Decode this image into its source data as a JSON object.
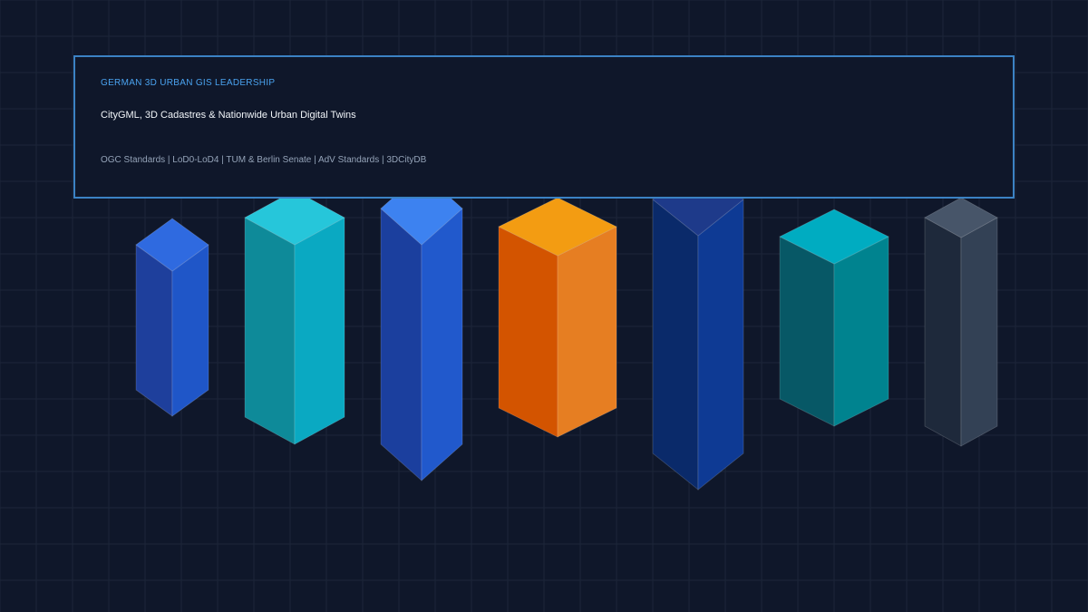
{
  "header": {
    "kicker": "GERMAN 3D URBAN GIS LEADERSHIP",
    "headline": "CityGML, 3D Cadastres & Nationwide Urban Digital Twins",
    "tags": "OGC Standards | LoD0-LoD4 | TUM & Berlin Senate | AdV Standards | 3DCityDB"
  },
  "colors": {
    "background": "#0f172a",
    "grid": "#1c2639",
    "panel_border": "#3b82c4",
    "kicker": "#4aa3f0"
  },
  "buildings": [
    {
      "name": "building-1",
      "top": "#2f6ae0",
      "left": "#1e3f9c",
      "right": "#1f56c8"
    },
    {
      "name": "building-2",
      "top": "#26c6da",
      "left": "#0e8a99",
      "right": "#0aa9c2"
    },
    {
      "name": "building-3",
      "top": "#3d82f0",
      "left": "#1b3f9e",
      "right": "#2159cc"
    },
    {
      "name": "building-4",
      "top": "#f39c12",
      "left": "#d35400",
      "right": "#e67e22"
    },
    {
      "name": "building-5",
      "top": "#1e3a8a",
      "left": "#0a2a6a",
      "right": "#0e3a94"
    },
    {
      "name": "building-6",
      "top": "#00acc1",
      "left": "#075866",
      "right": "#00838f"
    },
    {
      "name": "building-7",
      "top": "#475569",
      "left": "#1e293b",
      "right": "#334155"
    }
  ]
}
